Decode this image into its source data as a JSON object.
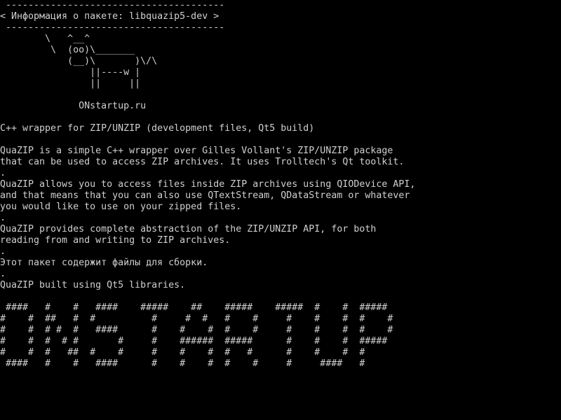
{
  "theme": {
    "background": "#000000",
    "foreground": "#d0d0d0"
  },
  "lines": [
    " ---------------------------------------",
    "< Информация о пакете: libquazip5-dev >",
    " ---------------------------------------",
    "        \\   ^__^",
    "         \\  (oo)\\_______",
    "            (__)\\       )\\/\\",
    "                ||----w |",
    "                ||     ||",
    "",
    "              ONstartup.ru",
    "",
    "C++ wrapper for ZIP/UNZIP (development files, Qt5 build)",
    "",
    "QuaZIP is a simple C++ wrapper over Gilles Vollant's ZIP/UNZIP package",
    "that can be used to access ZIP archives. It uses Trolltech's Qt toolkit.",
    ".",
    "QuaZIP allows you to access files inside ZIP archives using QIODevice API,",
    "and that means that you can also use QTextStream, QDataStream or whatever",
    "you would like to use on your zipped files.",
    ".",
    "QuaZIP provides complete abstraction of the ZIP/UNZIP API, for both",
    "reading from and writing to ZIP archives.",
    ".",
    "Этот пакет содержит файлы для сборки.",
    ".",
    "QuaZIP built using Qt5 libraries.",
    "",
    " ####   #    #   ####    #####    ##    #####    #####  #    #  #####",
    "#    #  ##   #  #          #     #  #   #    #     #    #    #  #    #",
    "#    #  # #  #   ####      #    #    #  #    #     #    #    #  #    #",
    "#    #  #  # #       #     #    ######  #####      #    #    #  #####",
    "#    #  #   ##  #    #     #    #    #  #   #      #    #    #  #",
    " ####   #    #   ####      #    #    #  #    #     #     ####   #"
  ]
}
